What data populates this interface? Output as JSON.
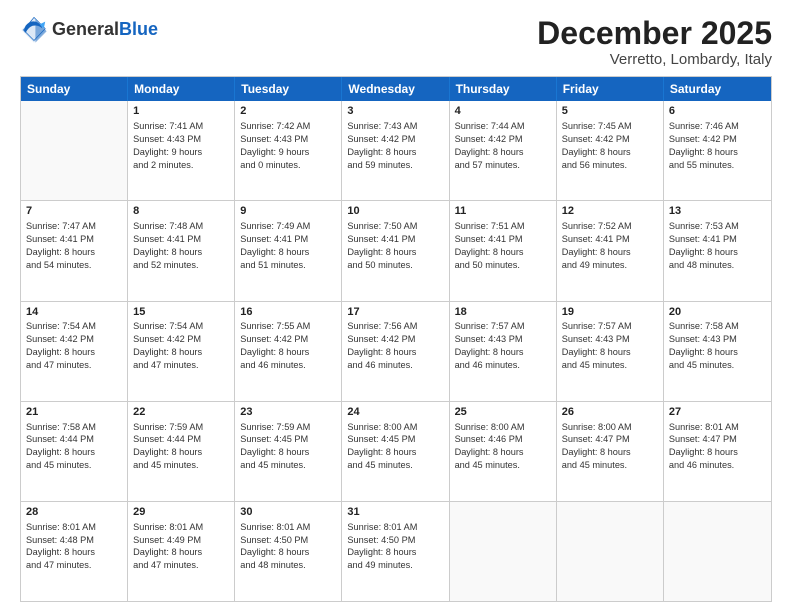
{
  "logo": {
    "general": "General",
    "blue": "Blue"
  },
  "title": "December 2025",
  "subtitle": "Verretto, Lombardy, Italy",
  "header_days": [
    "Sunday",
    "Monday",
    "Tuesday",
    "Wednesday",
    "Thursday",
    "Friday",
    "Saturday"
  ],
  "weeks": [
    [
      {
        "day": "",
        "sunrise": "",
        "sunset": "",
        "daylight": "",
        "empty": true
      },
      {
        "day": "1",
        "sunrise": "Sunrise: 7:41 AM",
        "sunset": "Sunset: 4:43 PM",
        "daylight": "Daylight: 9 hours and 2 minutes."
      },
      {
        "day": "2",
        "sunrise": "Sunrise: 7:42 AM",
        "sunset": "Sunset: 4:43 PM",
        "daylight": "Daylight: 9 hours and 0 minutes."
      },
      {
        "day": "3",
        "sunrise": "Sunrise: 7:43 AM",
        "sunset": "Sunset: 4:42 PM",
        "daylight": "Daylight: 8 hours and 59 minutes."
      },
      {
        "day": "4",
        "sunrise": "Sunrise: 7:44 AM",
        "sunset": "Sunset: 4:42 PM",
        "daylight": "Daylight: 8 hours and 57 minutes."
      },
      {
        "day": "5",
        "sunrise": "Sunrise: 7:45 AM",
        "sunset": "Sunset: 4:42 PM",
        "daylight": "Daylight: 8 hours and 56 minutes."
      },
      {
        "day": "6",
        "sunrise": "Sunrise: 7:46 AM",
        "sunset": "Sunset: 4:42 PM",
        "daylight": "Daylight: 8 hours and 55 minutes."
      }
    ],
    [
      {
        "day": "7",
        "sunrise": "Sunrise: 7:47 AM",
        "sunset": "Sunset: 4:41 PM",
        "daylight": "Daylight: 8 hours and 54 minutes."
      },
      {
        "day": "8",
        "sunrise": "Sunrise: 7:48 AM",
        "sunset": "Sunset: 4:41 PM",
        "daylight": "Daylight: 8 hours and 52 minutes."
      },
      {
        "day": "9",
        "sunrise": "Sunrise: 7:49 AM",
        "sunset": "Sunset: 4:41 PM",
        "daylight": "Daylight: 8 hours and 51 minutes."
      },
      {
        "day": "10",
        "sunrise": "Sunrise: 7:50 AM",
        "sunset": "Sunset: 4:41 PM",
        "daylight": "Daylight: 8 hours and 50 minutes."
      },
      {
        "day": "11",
        "sunrise": "Sunrise: 7:51 AM",
        "sunset": "Sunset: 4:41 PM",
        "daylight": "Daylight: 8 hours and 50 minutes."
      },
      {
        "day": "12",
        "sunrise": "Sunrise: 7:52 AM",
        "sunset": "Sunset: 4:41 PM",
        "daylight": "Daylight: 8 hours and 49 minutes."
      },
      {
        "day": "13",
        "sunrise": "Sunrise: 7:53 AM",
        "sunset": "Sunset: 4:41 PM",
        "daylight": "Daylight: 8 hours and 48 minutes."
      }
    ],
    [
      {
        "day": "14",
        "sunrise": "Sunrise: 7:54 AM",
        "sunset": "Sunset: 4:42 PM",
        "daylight": "Daylight: 8 hours and 47 minutes."
      },
      {
        "day": "15",
        "sunrise": "Sunrise: 7:54 AM",
        "sunset": "Sunset: 4:42 PM",
        "daylight": "Daylight: 8 hours and 47 minutes."
      },
      {
        "day": "16",
        "sunrise": "Sunrise: 7:55 AM",
        "sunset": "Sunset: 4:42 PM",
        "daylight": "Daylight: 8 hours and 46 minutes."
      },
      {
        "day": "17",
        "sunrise": "Sunrise: 7:56 AM",
        "sunset": "Sunset: 4:42 PM",
        "daylight": "Daylight: 8 hours and 46 minutes."
      },
      {
        "day": "18",
        "sunrise": "Sunrise: 7:57 AM",
        "sunset": "Sunset: 4:43 PM",
        "daylight": "Daylight: 8 hours and 46 minutes."
      },
      {
        "day": "19",
        "sunrise": "Sunrise: 7:57 AM",
        "sunset": "Sunset: 4:43 PM",
        "daylight": "Daylight: 8 hours and 45 minutes."
      },
      {
        "day": "20",
        "sunrise": "Sunrise: 7:58 AM",
        "sunset": "Sunset: 4:43 PM",
        "daylight": "Daylight: 8 hours and 45 minutes."
      }
    ],
    [
      {
        "day": "21",
        "sunrise": "Sunrise: 7:58 AM",
        "sunset": "Sunset: 4:44 PM",
        "daylight": "Daylight: 8 hours and 45 minutes."
      },
      {
        "day": "22",
        "sunrise": "Sunrise: 7:59 AM",
        "sunset": "Sunset: 4:44 PM",
        "daylight": "Daylight: 8 hours and 45 minutes."
      },
      {
        "day": "23",
        "sunrise": "Sunrise: 7:59 AM",
        "sunset": "Sunset: 4:45 PM",
        "daylight": "Daylight: 8 hours and 45 minutes."
      },
      {
        "day": "24",
        "sunrise": "Sunrise: 8:00 AM",
        "sunset": "Sunset: 4:45 PM",
        "daylight": "Daylight: 8 hours and 45 minutes."
      },
      {
        "day": "25",
        "sunrise": "Sunrise: 8:00 AM",
        "sunset": "Sunset: 4:46 PM",
        "daylight": "Daylight: 8 hours and 45 minutes."
      },
      {
        "day": "26",
        "sunrise": "Sunrise: 8:00 AM",
        "sunset": "Sunset: 4:47 PM",
        "daylight": "Daylight: 8 hours and 45 minutes."
      },
      {
        "day": "27",
        "sunrise": "Sunrise: 8:01 AM",
        "sunset": "Sunset: 4:47 PM",
        "daylight": "Daylight: 8 hours and 46 minutes."
      }
    ],
    [
      {
        "day": "28",
        "sunrise": "Sunrise: 8:01 AM",
        "sunset": "Sunset: 4:48 PM",
        "daylight": "Daylight: 8 hours and 47 minutes."
      },
      {
        "day": "29",
        "sunrise": "Sunrise: 8:01 AM",
        "sunset": "Sunset: 4:49 PM",
        "daylight": "Daylight: 8 hours and 47 minutes."
      },
      {
        "day": "30",
        "sunrise": "Sunrise: 8:01 AM",
        "sunset": "Sunset: 4:50 PM",
        "daylight": "Daylight: 8 hours and 48 minutes."
      },
      {
        "day": "31",
        "sunrise": "Sunrise: 8:01 AM",
        "sunset": "Sunset: 4:50 PM",
        "daylight": "Daylight: 8 hours and 49 minutes."
      },
      {
        "day": "",
        "sunrise": "",
        "sunset": "",
        "daylight": "",
        "empty": true
      },
      {
        "day": "",
        "sunrise": "",
        "sunset": "",
        "daylight": "",
        "empty": true
      },
      {
        "day": "",
        "sunrise": "",
        "sunset": "",
        "daylight": "",
        "empty": true
      }
    ]
  ]
}
